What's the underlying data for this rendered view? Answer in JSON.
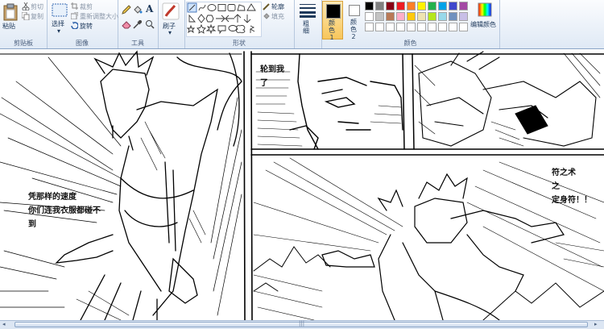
{
  "clipboard": {
    "paste": "粘贴",
    "cut": "剪切",
    "copy": "复制",
    "group": "剪贴板"
  },
  "image": {
    "select": "选择",
    "crop": "裁剪",
    "resize": "重新调整大小",
    "rotate": "旋转",
    "group": "图像"
  },
  "tools": {
    "group": "工具",
    "text_tool": "A"
  },
  "brushes": {
    "label": "刷子"
  },
  "shapes": {
    "outline": "轮廓",
    "fill": "填充",
    "group": "形状"
  },
  "size": {
    "label": "粗细"
  },
  "colors": {
    "color1": "颜色 1",
    "color2": "颜色 2",
    "edit": "编辑颜色",
    "group": "颜色",
    "color1_value": "#000000",
    "color2_value": "#ffffff",
    "palette_row1": [
      "#000000",
      "#7f7f7f",
      "#880015",
      "#ed1c24",
      "#ff7f27",
      "#fff200",
      "#22b14c",
      "#00a2e8",
      "#3f48cc",
      "#a349a4"
    ],
    "palette_row2": [
      "#ffffff",
      "#c3c3c3",
      "#b97a57",
      "#ffaec9",
      "#ffc90e",
      "#efe4b0",
      "#b5e61d",
      "#99d9ea",
      "#7092be",
      "#c8bfe7"
    ]
  },
  "comic": {
    "panel1_line1": "凭那样的速度",
    "panel1_line2": "你们连我衣服都碰不",
    "panel1_line3": "到",
    "panel2_line1": "轮到我",
    "panel2_line2": "了",
    "panel4_line1": "符之术",
    "panel4_line2": "之",
    "panel4_line3": "定身符！！"
  },
  "scrollbar": {
    "grip": "|||"
  }
}
